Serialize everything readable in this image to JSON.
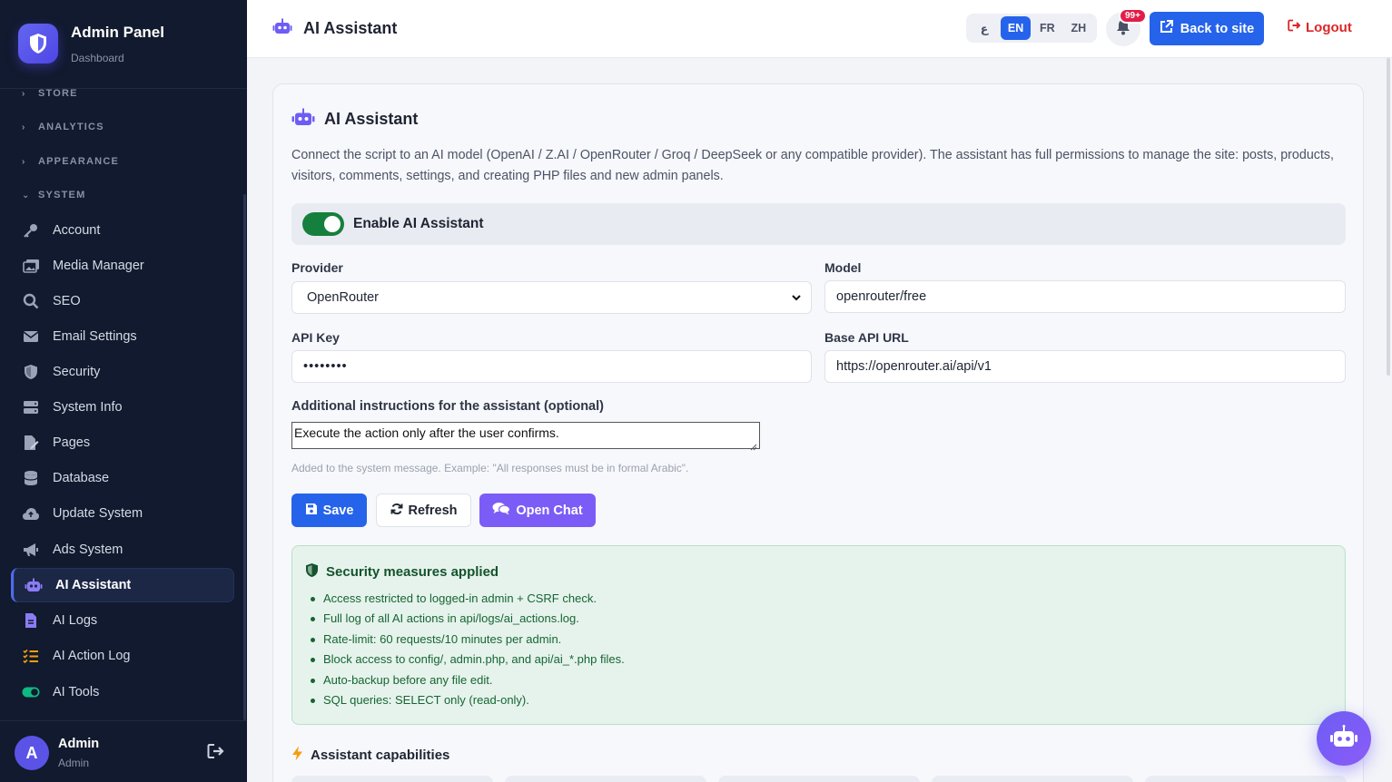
{
  "brand": {
    "title": "Admin Panel",
    "subtitle": "Dashboard"
  },
  "sidebar": {
    "sections": [
      {
        "label": "STORE",
        "expanded": false
      },
      {
        "label": "ANALYTICS",
        "expanded": false
      },
      {
        "label": "APPEARANCE",
        "expanded": false
      },
      {
        "label": "SYSTEM",
        "expanded": true
      }
    ],
    "items": [
      {
        "label": "Account",
        "icon": "key-icon"
      },
      {
        "label": "Media Manager",
        "icon": "images-icon"
      },
      {
        "label": "SEO",
        "icon": "search-icon"
      },
      {
        "label": "Email Settings",
        "icon": "envelope-icon"
      },
      {
        "label": "Security",
        "icon": "shield-icon"
      },
      {
        "label": "System Info",
        "icon": "server-icon"
      },
      {
        "label": "Pages",
        "icon": "file-edit-icon"
      },
      {
        "label": "Database",
        "icon": "database-icon"
      },
      {
        "label": "Update System",
        "icon": "cloud-icon"
      },
      {
        "label": "Ads System",
        "icon": "megaphone-icon"
      },
      {
        "label": "AI Assistant",
        "icon": "robot-icon",
        "active": true
      },
      {
        "label": "AI Logs",
        "icon": "file-text-icon"
      },
      {
        "label": "AI Action Log",
        "icon": "list-check-icon"
      },
      {
        "label": "AI Tools",
        "icon": "toggle-icon"
      }
    ],
    "user": {
      "initial": "A",
      "name": "Admin",
      "role": "Admin"
    }
  },
  "topbar": {
    "title": "AI Assistant",
    "languages": [
      {
        "code": "ع",
        "active": false
      },
      {
        "code": "EN",
        "active": true
      },
      {
        "code": "FR",
        "active": false
      },
      {
        "code": "ZH",
        "active": false
      }
    ],
    "notifications_badge": "99+",
    "back_label": "Back to site",
    "logout_label": "Logout"
  },
  "main": {
    "title": "AI Assistant",
    "description": "Connect the script to an AI model (OpenAI / Z.AI / OpenRouter / Groq / DeepSeek or any compatible provider). The assistant has full permissions to manage the site: posts, products, visitors, comments, settings, and creating PHP files and new admin panels.",
    "enable_label": "Enable AI Assistant",
    "enabled": true,
    "provider_label": "Provider",
    "provider_value": "OpenRouter",
    "model_label": "Model",
    "model_value": "openrouter/free",
    "api_key_label": "API Key",
    "api_key_value": "••••••••",
    "base_url_label": "Base API URL",
    "base_url_value": "https://openrouter.ai/api/v1",
    "instructions_label": "Additional instructions for the assistant (optional)",
    "instructions_value": "Execute the action only after the user confirms.",
    "instructions_hint": "Added to the system message. Example: \"All responses must be in formal Arabic\".",
    "save_label": "Save",
    "refresh_label": "Refresh",
    "chat_label": "Open Chat",
    "security_title": "Security measures applied",
    "security_items": [
      "Access restricted to logged-in admin + CSRF check.",
      "Full log of all AI actions in api/logs/ai_actions.log.",
      "Rate-limit: 60 requests/10 minutes per admin.",
      "Block access to config/, admin.php, and api/ai_*.php files.",
      "Auto-backup before any file edit.",
      "SQL queries: SELECT only (read-only)."
    ],
    "capabilities_title": "Assistant capabilities"
  },
  "colors": {
    "accent": "#2563eb",
    "sidebar_bg": "#111a2e",
    "success": "#15803d",
    "chat": "#7c5cf6",
    "danger": "#dc2626"
  }
}
